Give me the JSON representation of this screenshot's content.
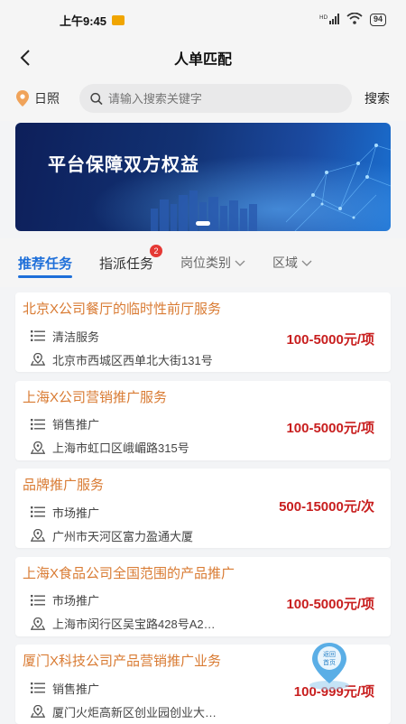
{
  "status_bar": {
    "time": "上午9:45",
    "signal": "HD",
    "battery": "94"
  },
  "header": {
    "title": "人单匹配"
  },
  "search": {
    "city": "日照",
    "placeholder": "请输入搜索关键字",
    "button": "搜索"
  },
  "banner": {
    "text": "平台保障双方权益"
  },
  "tabs": [
    {
      "label": "推荐任务",
      "active": true
    },
    {
      "label": "指派任务",
      "badge": "2"
    },
    {
      "label": "岗位类别",
      "dropdown": true
    },
    {
      "label": "区域",
      "dropdown": true
    }
  ],
  "tasks": [
    {
      "title": "北京X公司餐厅的临时性前厅服务",
      "category": "清洁服务",
      "address": "北京市西城区西单北大街131号",
      "price": "100-5000元/项"
    },
    {
      "title": "上海X公司营销推广服务",
      "category": "销售推广",
      "address": "上海市虹口区峨嵋路315号",
      "price": "100-5000元/项"
    },
    {
      "title": "品牌推广服务",
      "category": "市场推广",
      "address": "广州市天河区富力盈通大厦",
      "price": "500-15000元/次"
    },
    {
      "title": "上海X食品公司全国范围的产品推广",
      "category": "市场推广",
      "address": "上海市闵行区吴宝路428号A2…",
      "price": "100-5000元/项"
    },
    {
      "title": "厦门X科技公司产品营销推广业务",
      "category": "销售推广",
      "address": "厦门火炬高新区创业园创业大…",
      "price": "100-999元/项"
    }
  ],
  "home_button": {
    "label": "返回首页"
  },
  "colors": {
    "accent": "#1e6fd9",
    "title_orange": "#d97b33",
    "price_red": "#c81e1e"
  }
}
